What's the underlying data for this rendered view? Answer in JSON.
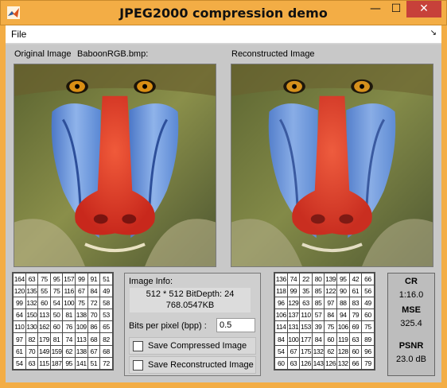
{
  "window": {
    "title": "JPEG2000 compression demo",
    "minimize_glyph": "—",
    "maximize_glyph": "☐",
    "close_glyph": "✕"
  },
  "menu": {
    "file": "File",
    "overflow_glyph": "↘"
  },
  "labels": {
    "original": "Original Image",
    "filename": "BaboonRGB.bmp:",
    "reconstructed": "Reconstructed Image"
  },
  "original_pixels": [
    [
      "164",
      "63",
      "75",
      "95",
      "157",
      "99",
      "91",
      "51"
    ],
    [
      "120",
      "135",
      "55",
      "75",
      "116",
      "67",
      "84",
      "49"
    ],
    [
      "99",
      "132",
      "60",
      "54",
      "100",
      "75",
      "72",
      "58"
    ],
    [
      "64",
      "150",
      "113",
      "50",
      "81",
      "138",
      "70",
      "53"
    ],
    [
      "110",
      "130",
      "162",
      "60",
      "76",
      "109",
      "86",
      "65"
    ],
    [
      "97",
      "82",
      "179",
      "81",
      "74",
      "113",
      "68",
      "82"
    ],
    [
      "61",
      "70",
      "149",
      "159",
      "62",
      "138",
      "67",
      "68"
    ],
    [
      "54",
      "63",
      "115",
      "187",
      "95",
      "141",
      "51",
      "72"
    ]
  ],
  "reconstructed_pixels": [
    [
      "136",
      "74",
      "22",
      "80",
      "139",
      "95",
      "42",
      "66"
    ],
    [
      "118",
      "99",
      "35",
      "85",
      "122",
      "90",
      "61",
      "56"
    ],
    [
      "96",
      "129",
      "63",
      "85",
      "97",
      "88",
      "83",
      "49"
    ],
    [
      "106",
      "137",
      "110",
      "57",
      "84",
      "94",
      "79",
      "60"
    ],
    [
      "114",
      "131",
      "153",
      "39",
      "75",
      "106",
      "69",
      "75"
    ],
    [
      "84",
      "100",
      "177",
      "84",
      "60",
      "119",
      "63",
      "89"
    ],
    [
      "54",
      "67",
      "175",
      "132",
      "62",
      "128",
      "60",
      "96"
    ],
    [
      "60",
      "63",
      "126",
      "143",
      "126",
      "132",
      "66",
      "79"
    ]
  ],
  "info": {
    "heading": "Image Info:",
    "line1": "512 * 512    BitDepth: 24",
    "line2": "768.0547KB",
    "bpp_label": "Bits per pixel (bpp) :",
    "bpp_value": "0.5",
    "save_compressed": "Save Compressed Image",
    "save_reconstructed": "Save Reconstructed Image"
  },
  "stats": {
    "cr_label": "CR",
    "cr_value": "1:16.0",
    "mse_label": "MSE",
    "mse_value": "325.4",
    "psnr_label": "PSNR",
    "psnr_value": "23.0 dB"
  },
  "colors": {
    "titlebar": "#f3ad45",
    "close_button": "#c7413a",
    "background": "#c8c8c8"
  }
}
